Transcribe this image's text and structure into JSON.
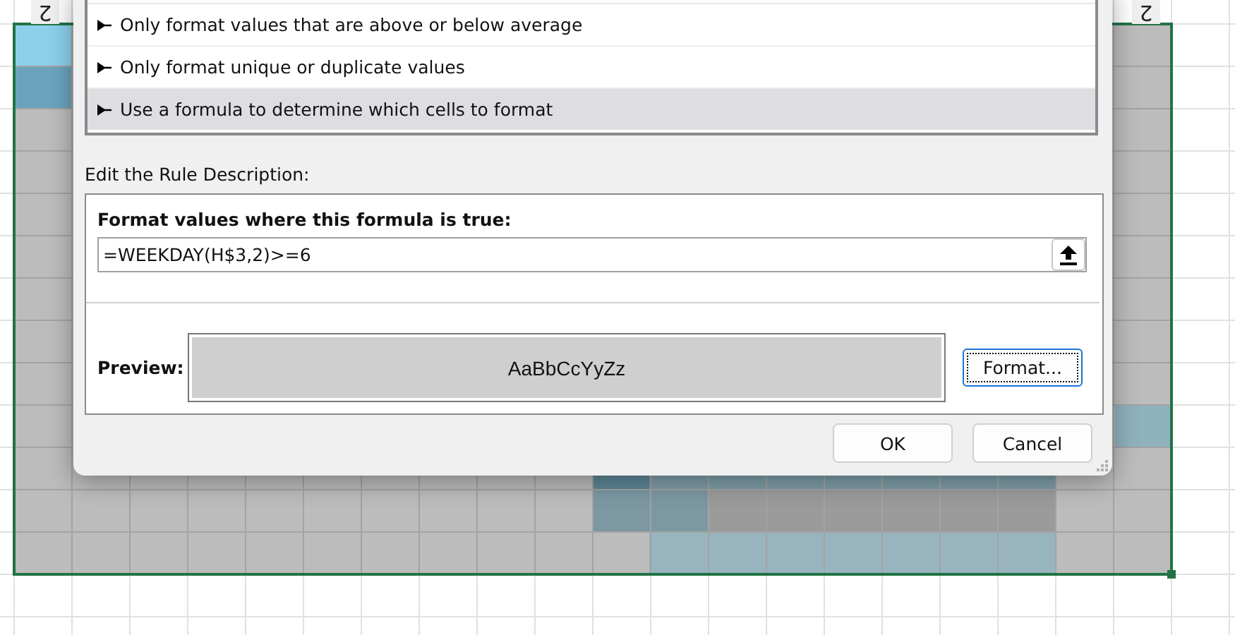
{
  "spreadsheet": {
    "column_headers": [
      "2",
      "2"
    ]
  },
  "dialog": {
    "rule_types": [
      {
        "label": "Only format values that are above or below average",
        "selected": false
      },
      {
        "label": "Only format unique or duplicate values",
        "selected": false
      },
      {
        "label": "Use a formula to determine which cells to format",
        "selected": true
      }
    ],
    "rule_description_label": "Edit the Rule Description:",
    "formula_label": "Format values where this formula is true:",
    "formula": "=WEEKDAY(H$3,2)>=6",
    "preview_label": "Preview:",
    "preview_sample": "AaBbCcYyZz",
    "format_button": "Format...",
    "buttons": [
      "OK",
      "Cancel"
    ]
  }
}
